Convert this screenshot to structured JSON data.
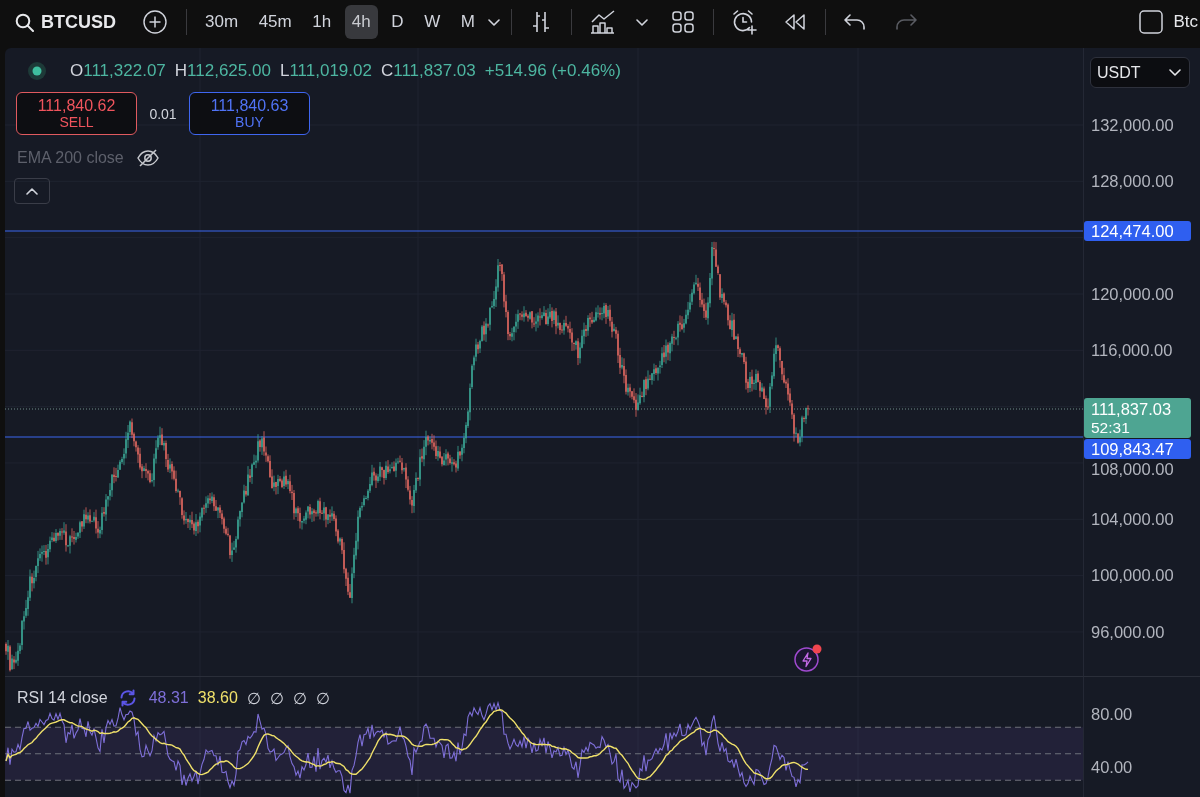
{
  "toolbar": {
    "symbol": "BTCUSD",
    "intervals": [
      {
        "label": "30m",
        "selected": false
      },
      {
        "label": "45m",
        "selected": false
      },
      {
        "label": "1h",
        "selected": false
      },
      {
        "label": "4h",
        "selected": true
      },
      {
        "label": "D",
        "selected": false
      },
      {
        "label": "W",
        "selected": false
      },
      {
        "label": "M",
        "selected": false
      }
    ],
    "history": [
      {
        "kind": "undo",
        "disabled": false
      },
      {
        "kind": "redo",
        "disabled": true
      }
    ],
    "right_label": "Btc"
  },
  "legend": {
    "market_open": true,
    "positive": true,
    "ohlc": [
      {
        "label": "O",
        "value": "111,322.07"
      },
      {
        "label": "H",
        "value": "112,625.00"
      },
      {
        "label": "L",
        "value": "111,019.02"
      },
      {
        "label": "C",
        "value": "111,837.03"
      }
    ],
    "change": "+514.96 (+0.46%)"
  },
  "trade": {
    "sell": {
      "price": "111,840.62",
      "label": "SELL"
    },
    "quantity": "0.01",
    "buy": {
      "price": "111,840.63",
      "label": "BUY"
    }
  },
  "indicators": [
    {
      "label": "EMA 200 close",
      "hidden": true
    }
  ],
  "price_axis": {
    "currency": "USDT",
    "ticks": [
      "132,000.00",
      "128,000.00",
      "120,000.00",
      "116,000.00",
      "108,000.00",
      "104,000.00",
      "100,000.00",
      "96,000.00"
    ],
    "markers": [
      {
        "kind": "line",
        "label": "124,474.00"
      },
      {
        "kind": "last_price",
        "label": "111,837.03",
        "countdown": "52:31"
      },
      {
        "kind": "line",
        "label": "109,843.47"
      }
    ]
  },
  "rsi": {
    "label": "RSI 14 close",
    "values": [
      {
        "value": "48.31",
        "color": "#7e6fd8"
      },
      {
        "value": "38.60",
        "color": "#efe06a"
      },
      {
        "value": "∅",
        "color": "#d1d4dc"
      },
      {
        "value": "∅",
        "color": "#d1d4dc"
      },
      {
        "value": "∅",
        "color": "#d1d4dc"
      },
      {
        "value": "∅",
        "color": "#d1d4dc"
      }
    ],
    "ticks": [
      "80.00",
      "40.00"
    ]
  }
}
